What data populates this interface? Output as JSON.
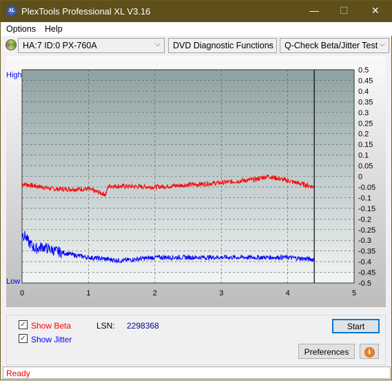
{
  "window": {
    "title": "PlexTools Professional XL V3.16",
    "logo": "XL",
    "minimize": "—",
    "maximize": "☐",
    "close": "✕"
  },
  "menu": {
    "options": "Options",
    "help": "Help"
  },
  "toolbar": {
    "drive": "HA:7 ID:0  PX-760A",
    "function": "DVD Diagnostic Functions",
    "test": "Q-Check Beta/Jitter Test"
  },
  "chart_data": {
    "type": "line",
    "xlim": [
      0,
      5
    ],
    "ylim": [
      -0.5,
      0.5
    ],
    "x_ticks": [
      "0",
      "1",
      "2",
      "3",
      "4",
      "5"
    ],
    "y_ticks": [
      "0.5",
      "0.45",
      "0.4",
      "0.35",
      "0.3",
      "0.25",
      "0.2",
      "0.15",
      "0.1",
      "0.05",
      "0",
      "-0.05",
      "-0.1",
      "-0.15",
      "-0.2",
      "-0.25",
      "-0.3",
      "-0.35",
      "-0.4",
      "-0.45",
      "-0.5"
    ],
    "left_labels": {
      "high": "High",
      "low": "Low"
    },
    "grid": true,
    "marker_x": 4.4,
    "series": [
      {
        "key": "beta",
        "color": "#ff0000",
        "x": [
          0,
          0.5,
          1.0,
          1.2,
          1.26,
          1.3,
          2.0,
          2.5,
          3.0,
          3.5,
          3.7,
          4.0,
          4.4
        ],
        "y": [
          -0.035,
          -0.06,
          -0.06,
          -0.08,
          -0.085,
          -0.045,
          -0.05,
          -0.04,
          -0.03,
          -0.015,
          0.0,
          -0.02,
          -0.05
        ]
      },
      {
        "key": "jitter",
        "color": "#0000ff",
        "x": [
          0,
          0.05,
          0.1,
          0.2,
          0.3,
          0.5,
          0.8,
          1.0,
          1.5,
          2.0,
          3.0,
          4.0,
          4.4
        ],
        "y": [
          -0.27,
          -0.28,
          -0.31,
          -0.34,
          -0.33,
          -0.35,
          -0.37,
          -0.38,
          -0.395,
          -0.38,
          -0.38,
          -0.38,
          -0.39
        ]
      }
    ]
  },
  "controls": {
    "show_beta": "Show Beta",
    "show_jitter": "Show Jitter",
    "lsn_label": "LSN:",
    "lsn_value": "2298368",
    "start": "Start",
    "preferences": "Preferences",
    "info_icon": "i",
    "beta_color": "#ff0000",
    "jitter_color": "#0000ff"
  },
  "status": "Ready"
}
